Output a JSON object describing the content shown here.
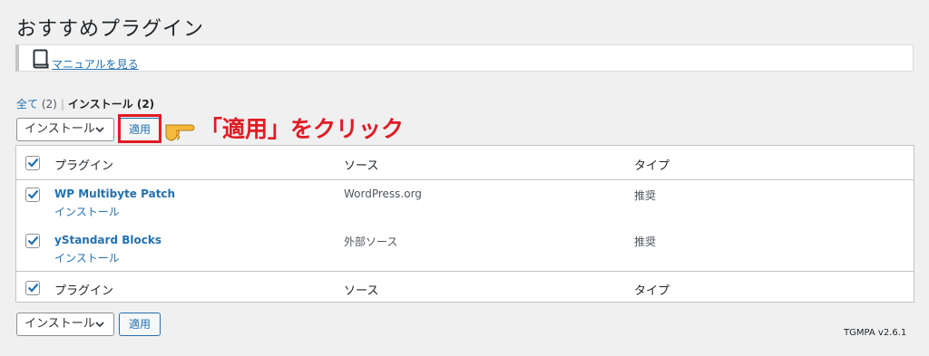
{
  "page": {
    "title": "おすすめプラグイン"
  },
  "notice": {
    "link_label": "マニュアルを見る"
  },
  "views": {
    "all_label": "全て",
    "all_count": "(2)",
    "separator": "|",
    "install_label": "インストール",
    "install_count": "(2)"
  },
  "bulk_top": {
    "select_value": "インストール",
    "apply_label": "適用"
  },
  "bulk_bottom": {
    "select_value": "インストール",
    "apply_label": "適用"
  },
  "annotation": {
    "text": "「適用」をクリック",
    "color": "#e01b24"
  },
  "table": {
    "columns": [
      "プラグイン",
      "ソース",
      "タイプ"
    ],
    "rows": [
      {
        "name": "WP Multibyte Patch",
        "action": "インストール",
        "source": "WordPress.org",
        "type": "推奨",
        "checked": true
      },
      {
        "name": "yStandard Blocks",
        "action": "インストール",
        "source": "外部ソース",
        "type": "推奨",
        "checked": true
      }
    ],
    "header_checked": true,
    "footer_checked": true
  },
  "footer": {
    "version": "TGMPA v2.6.1"
  },
  "icons": {
    "book": "book-icon",
    "hand": "pointing-hand-icon",
    "chevron": "chevron-down-icon",
    "check": "checkmark-icon"
  },
  "colors": {
    "accent": "#2271b1",
    "highlight": "#e01b24",
    "background": "#f0f0f1"
  }
}
